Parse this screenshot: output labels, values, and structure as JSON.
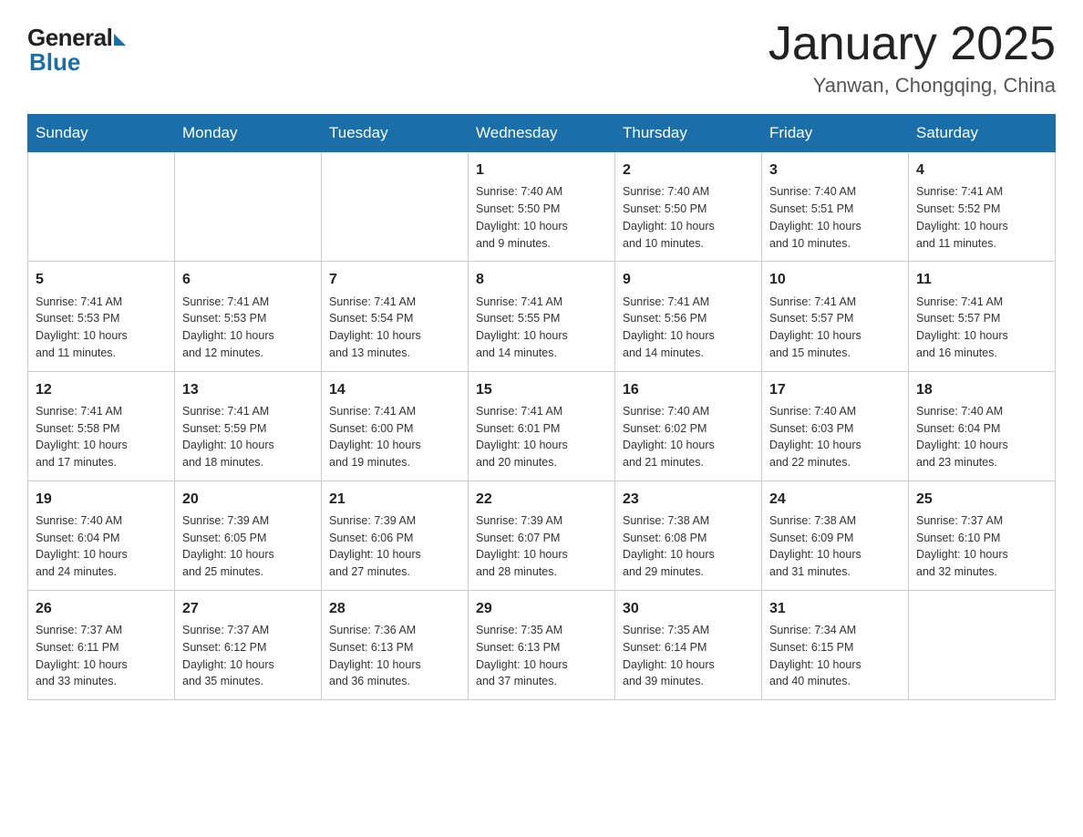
{
  "header": {
    "logo_general": "General",
    "logo_blue": "Blue",
    "title": "January 2025",
    "subtitle": "Yanwan, Chongqing, China"
  },
  "days_of_week": [
    "Sunday",
    "Monday",
    "Tuesday",
    "Wednesday",
    "Thursday",
    "Friday",
    "Saturday"
  ],
  "weeks": [
    [
      {
        "day": "",
        "info": ""
      },
      {
        "day": "",
        "info": ""
      },
      {
        "day": "",
        "info": ""
      },
      {
        "day": "1",
        "info": "Sunrise: 7:40 AM\nSunset: 5:50 PM\nDaylight: 10 hours\nand 9 minutes."
      },
      {
        "day": "2",
        "info": "Sunrise: 7:40 AM\nSunset: 5:50 PM\nDaylight: 10 hours\nand 10 minutes."
      },
      {
        "day": "3",
        "info": "Sunrise: 7:40 AM\nSunset: 5:51 PM\nDaylight: 10 hours\nand 10 minutes."
      },
      {
        "day": "4",
        "info": "Sunrise: 7:41 AM\nSunset: 5:52 PM\nDaylight: 10 hours\nand 11 minutes."
      }
    ],
    [
      {
        "day": "5",
        "info": "Sunrise: 7:41 AM\nSunset: 5:53 PM\nDaylight: 10 hours\nand 11 minutes."
      },
      {
        "day": "6",
        "info": "Sunrise: 7:41 AM\nSunset: 5:53 PM\nDaylight: 10 hours\nand 12 minutes."
      },
      {
        "day": "7",
        "info": "Sunrise: 7:41 AM\nSunset: 5:54 PM\nDaylight: 10 hours\nand 13 minutes."
      },
      {
        "day": "8",
        "info": "Sunrise: 7:41 AM\nSunset: 5:55 PM\nDaylight: 10 hours\nand 14 minutes."
      },
      {
        "day": "9",
        "info": "Sunrise: 7:41 AM\nSunset: 5:56 PM\nDaylight: 10 hours\nand 14 minutes."
      },
      {
        "day": "10",
        "info": "Sunrise: 7:41 AM\nSunset: 5:57 PM\nDaylight: 10 hours\nand 15 minutes."
      },
      {
        "day": "11",
        "info": "Sunrise: 7:41 AM\nSunset: 5:57 PM\nDaylight: 10 hours\nand 16 minutes."
      }
    ],
    [
      {
        "day": "12",
        "info": "Sunrise: 7:41 AM\nSunset: 5:58 PM\nDaylight: 10 hours\nand 17 minutes."
      },
      {
        "day": "13",
        "info": "Sunrise: 7:41 AM\nSunset: 5:59 PM\nDaylight: 10 hours\nand 18 minutes."
      },
      {
        "day": "14",
        "info": "Sunrise: 7:41 AM\nSunset: 6:00 PM\nDaylight: 10 hours\nand 19 minutes."
      },
      {
        "day": "15",
        "info": "Sunrise: 7:41 AM\nSunset: 6:01 PM\nDaylight: 10 hours\nand 20 minutes."
      },
      {
        "day": "16",
        "info": "Sunrise: 7:40 AM\nSunset: 6:02 PM\nDaylight: 10 hours\nand 21 minutes."
      },
      {
        "day": "17",
        "info": "Sunrise: 7:40 AM\nSunset: 6:03 PM\nDaylight: 10 hours\nand 22 minutes."
      },
      {
        "day": "18",
        "info": "Sunrise: 7:40 AM\nSunset: 6:04 PM\nDaylight: 10 hours\nand 23 minutes."
      }
    ],
    [
      {
        "day": "19",
        "info": "Sunrise: 7:40 AM\nSunset: 6:04 PM\nDaylight: 10 hours\nand 24 minutes."
      },
      {
        "day": "20",
        "info": "Sunrise: 7:39 AM\nSunset: 6:05 PM\nDaylight: 10 hours\nand 25 minutes."
      },
      {
        "day": "21",
        "info": "Sunrise: 7:39 AM\nSunset: 6:06 PM\nDaylight: 10 hours\nand 27 minutes."
      },
      {
        "day": "22",
        "info": "Sunrise: 7:39 AM\nSunset: 6:07 PM\nDaylight: 10 hours\nand 28 minutes."
      },
      {
        "day": "23",
        "info": "Sunrise: 7:38 AM\nSunset: 6:08 PM\nDaylight: 10 hours\nand 29 minutes."
      },
      {
        "day": "24",
        "info": "Sunrise: 7:38 AM\nSunset: 6:09 PM\nDaylight: 10 hours\nand 31 minutes."
      },
      {
        "day": "25",
        "info": "Sunrise: 7:37 AM\nSunset: 6:10 PM\nDaylight: 10 hours\nand 32 minutes."
      }
    ],
    [
      {
        "day": "26",
        "info": "Sunrise: 7:37 AM\nSunset: 6:11 PM\nDaylight: 10 hours\nand 33 minutes."
      },
      {
        "day": "27",
        "info": "Sunrise: 7:37 AM\nSunset: 6:12 PM\nDaylight: 10 hours\nand 35 minutes."
      },
      {
        "day": "28",
        "info": "Sunrise: 7:36 AM\nSunset: 6:13 PM\nDaylight: 10 hours\nand 36 minutes."
      },
      {
        "day": "29",
        "info": "Sunrise: 7:35 AM\nSunset: 6:13 PM\nDaylight: 10 hours\nand 37 minutes."
      },
      {
        "day": "30",
        "info": "Sunrise: 7:35 AM\nSunset: 6:14 PM\nDaylight: 10 hours\nand 39 minutes."
      },
      {
        "day": "31",
        "info": "Sunrise: 7:34 AM\nSunset: 6:15 PM\nDaylight: 10 hours\nand 40 minutes."
      },
      {
        "day": "",
        "info": ""
      }
    ]
  ]
}
